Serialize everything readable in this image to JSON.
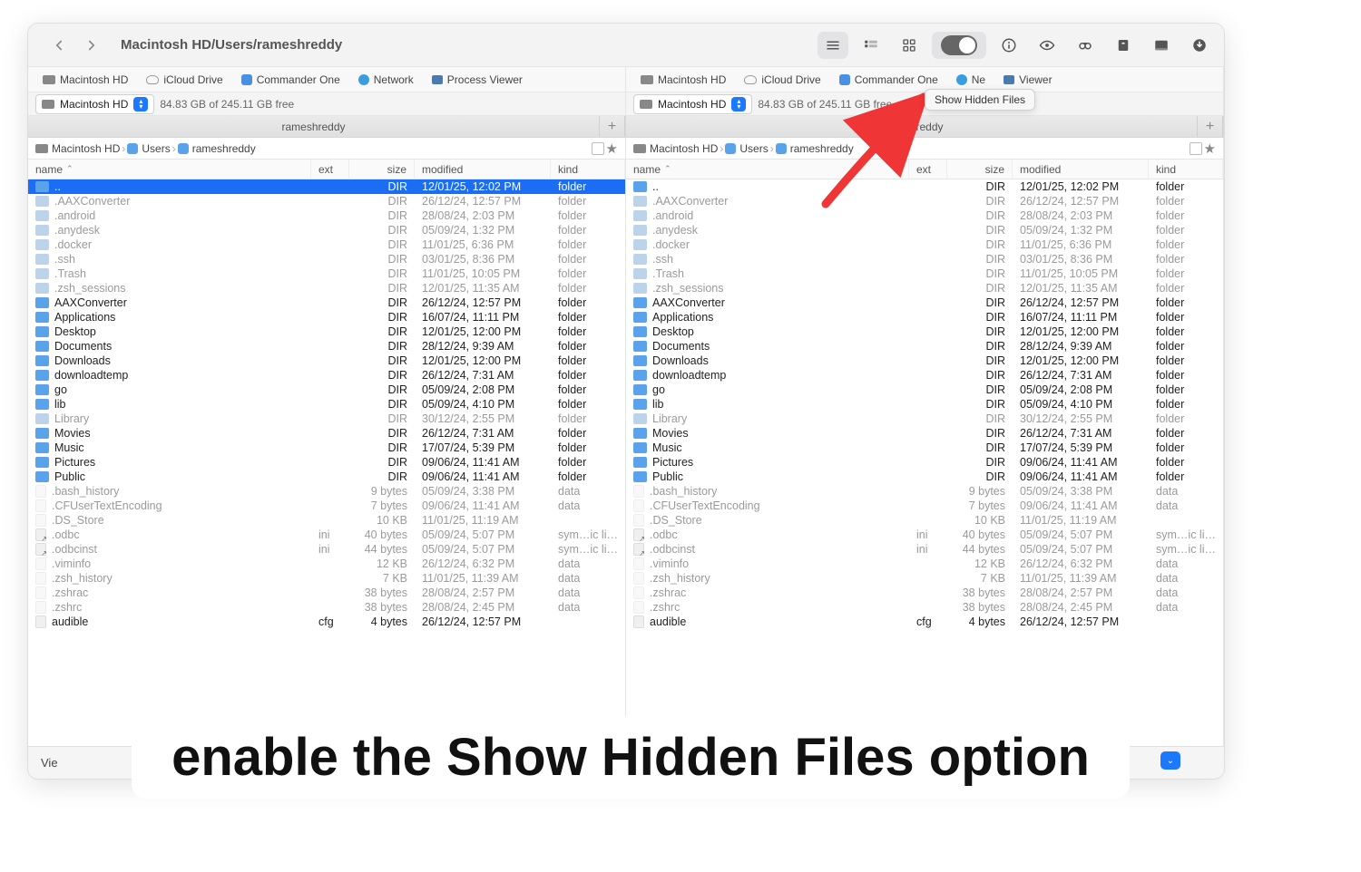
{
  "window": {
    "path": "Macintosh HD/Users/rameshreddy",
    "tooltip": "Show Hidden Files"
  },
  "favorites": [
    {
      "icon": "hd",
      "label": "Macintosh HD"
    },
    {
      "icon": "cloud",
      "label": "iCloud Drive"
    },
    {
      "icon": "app",
      "label": "Commander One"
    },
    {
      "icon": "net",
      "label": "Network"
    },
    {
      "icon": "proc",
      "label": "Process Viewer"
    }
  ],
  "favorites_right_visible": [
    {
      "icon": "hd",
      "label": "Macintosh HD"
    },
    {
      "icon": "cloud",
      "label": "iCloud Drive"
    },
    {
      "icon": "app",
      "label": "Commander One"
    },
    {
      "icon": "net",
      "label": "Ne"
    },
    {
      "icon": "proc",
      "label": "Viewer"
    }
  ],
  "drive": {
    "name": "Macintosh HD",
    "free": "84.83 GB of 245.11 GB free"
  },
  "tab": {
    "label": "rameshreddy"
  },
  "crumbs": [
    "Macintosh HD",
    "Users",
    "rameshreddy"
  ],
  "columns": {
    "name": "name",
    "ext": "ext",
    "size": "size",
    "mod": "modified",
    "kind": "kind"
  },
  "rows": [
    {
      "sel": true,
      "hidden": false,
      "icon": "folder",
      "name": "..",
      "ext": "",
      "size": "DIR",
      "mod": "12/01/25, 12:02 PM",
      "kind": "folder"
    },
    {
      "hidden": true,
      "icon": "folder-dim",
      "name": ".AAXConverter",
      "ext": "",
      "size": "DIR",
      "mod": "26/12/24, 12:57 PM",
      "kind": "folder"
    },
    {
      "hidden": true,
      "icon": "folder-dim",
      "name": ".android",
      "ext": "",
      "size": "DIR",
      "mod": "28/08/24, 2:03 PM",
      "kind": "folder"
    },
    {
      "hidden": true,
      "icon": "folder-dim",
      "name": ".anydesk",
      "ext": "",
      "size": "DIR",
      "mod": "05/09/24, 1:32 PM",
      "kind": "folder"
    },
    {
      "hidden": true,
      "icon": "folder-dim",
      "name": ".docker",
      "ext": "",
      "size": "DIR",
      "mod": "11/01/25, 6:36 PM",
      "kind": "folder"
    },
    {
      "hidden": true,
      "icon": "folder-dim",
      "name": ".ssh",
      "ext": "",
      "size": "DIR",
      "mod": "03/01/25, 8:36 PM",
      "kind": "folder"
    },
    {
      "hidden": true,
      "icon": "folder-dim",
      "name": ".Trash",
      "ext": "",
      "size": "DIR",
      "mod": "11/01/25, 10:05 PM",
      "kind": "folder"
    },
    {
      "hidden": true,
      "icon": "folder-dim",
      "name": ".zsh_sessions",
      "ext": "",
      "size": "DIR",
      "mod": "12/01/25, 11:35 AM",
      "kind": "folder"
    },
    {
      "hidden": false,
      "icon": "folder",
      "name": "AAXConverter",
      "ext": "",
      "size": "DIR",
      "mod": "26/12/24, 12:57 PM",
      "kind": "folder"
    },
    {
      "hidden": false,
      "icon": "folder",
      "name": "Applications",
      "ext": "",
      "size": "DIR",
      "mod": "16/07/24, 11:11 PM",
      "kind": "folder"
    },
    {
      "hidden": false,
      "icon": "folder",
      "name": "Desktop",
      "ext": "",
      "size": "DIR",
      "mod": "12/01/25, 12:00 PM",
      "kind": "folder"
    },
    {
      "hidden": false,
      "icon": "folder",
      "name": "Documents",
      "ext": "",
      "size": "DIR",
      "mod": "28/12/24, 9:39 AM",
      "kind": "folder"
    },
    {
      "hidden": false,
      "icon": "folder",
      "name": "Downloads",
      "ext": "",
      "size": "DIR",
      "mod": "12/01/25, 12:00 PM",
      "kind": "folder"
    },
    {
      "hidden": false,
      "icon": "folder",
      "name": "downloadtemp",
      "ext": "",
      "size": "DIR",
      "mod": "26/12/24, 7:31 AM",
      "kind": "folder"
    },
    {
      "hidden": false,
      "icon": "folder",
      "name": "go",
      "ext": "",
      "size": "DIR",
      "mod": "05/09/24, 2:08 PM",
      "kind": "folder"
    },
    {
      "hidden": false,
      "icon": "folder",
      "name": "lib",
      "ext": "",
      "size": "DIR",
      "mod": "05/09/24, 4:10 PM",
      "kind": "folder"
    },
    {
      "hidden": true,
      "icon": "folder-dim",
      "name": "Library",
      "ext": "",
      "size": "DIR",
      "mod": "30/12/24, 2:55 PM",
      "kind": "folder"
    },
    {
      "hidden": false,
      "icon": "folder",
      "name": "Movies",
      "ext": "",
      "size": "DIR",
      "mod": "26/12/24, 7:31 AM",
      "kind": "folder"
    },
    {
      "hidden": false,
      "icon": "folder",
      "name": "Music",
      "ext": "",
      "size": "DIR",
      "mod": "17/07/24, 5:39 PM",
      "kind": "folder"
    },
    {
      "hidden": false,
      "icon": "folder",
      "name": "Pictures",
      "ext": "",
      "size": "DIR",
      "mod": "09/06/24, 11:41 AM",
      "kind": "folder"
    },
    {
      "hidden": false,
      "icon": "folder",
      "name": "Public",
      "ext": "",
      "size": "DIR",
      "mod": "09/06/24, 11:41 AM",
      "kind": "folder"
    },
    {
      "hidden": true,
      "icon": "file-dim",
      "name": ".bash_history",
      "ext": "",
      "size": "9 bytes",
      "mod": "05/09/24, 3:38 PM",
      "kind": "data"
    },
    {
      "hidden": true,
      "icon": "file-dim",
      "name": ".CFUserTextEncoding",
      "ext": "",
      "size": "7 bytes",
      "mod": "09/06/24, 11:41 AM",
      "kind": "data"
    },
    {
      "hidden": true,
      "icon": "file-dim",
      "name": ".DS_Store",
      "ext": "",
      "size": "10 KB",
      "mod": "11/01/25, 11:19 AM",
      "kind": ""
    },
    {
      "hidden": true,
      "icon": "link",
      "name": ".odbc",
      "ext": "ini",
      "size": "40 bytes",
      "mod": "05/09/24, 5:07 PM",
      "kind": "sym…ic link"
    },
    {
      "hidden": true,
      "icon": "link",
      "name": ".odbcinst",
      "ext": "ini",
      "size": "44 bytes",
      "mod": "05/09/24, 5:07 PM",
      "kind": "sym…ic link"
    },
    {
      "hidden": true,
      "icon": "file-dim",
      "name": ".viminfo",
      "ext": "",
      "size": "12 KB",
      "mod": "26/12/24, 6:32 PM",
      "kind": "data"
    },
    {
      "hidden": true,
      "icon": "file-dim",
      "name": ".zsh_history",
      "ext": "",
      "size": "7 KB",
      "mod": "11/01/25, 11:39 AM",
      "kind": "data"
    },
    {
      "hidden": true,
      "icon": "file-dim",
      "name": ".zshrac",
      "ext": "",
      "size": "38 bytes",
      "mod": "28/08/24, 2:57 PM",
      "kind": "data"
    },
    {
      "hidden": true,
      "icon": "file-dim",
      "name": ".zshrc",
      "ext": "",
      "size": "38 bytes",
      "mod": "28/08/24, 2:45 PM",
      "kind": "data"
    },
    {
      "hidden": false,
      "icon": "file",
      "name": "audible",
      "ext": "cfg",
      "size": "4 bytes",
      "mod": "26/12/24, 12:57 PM",
      "kind": ""
    }
  ],
  "footer": {
    "view": "Vie"
  },
  "caption": "enable the Show Hidden Files option"
}
